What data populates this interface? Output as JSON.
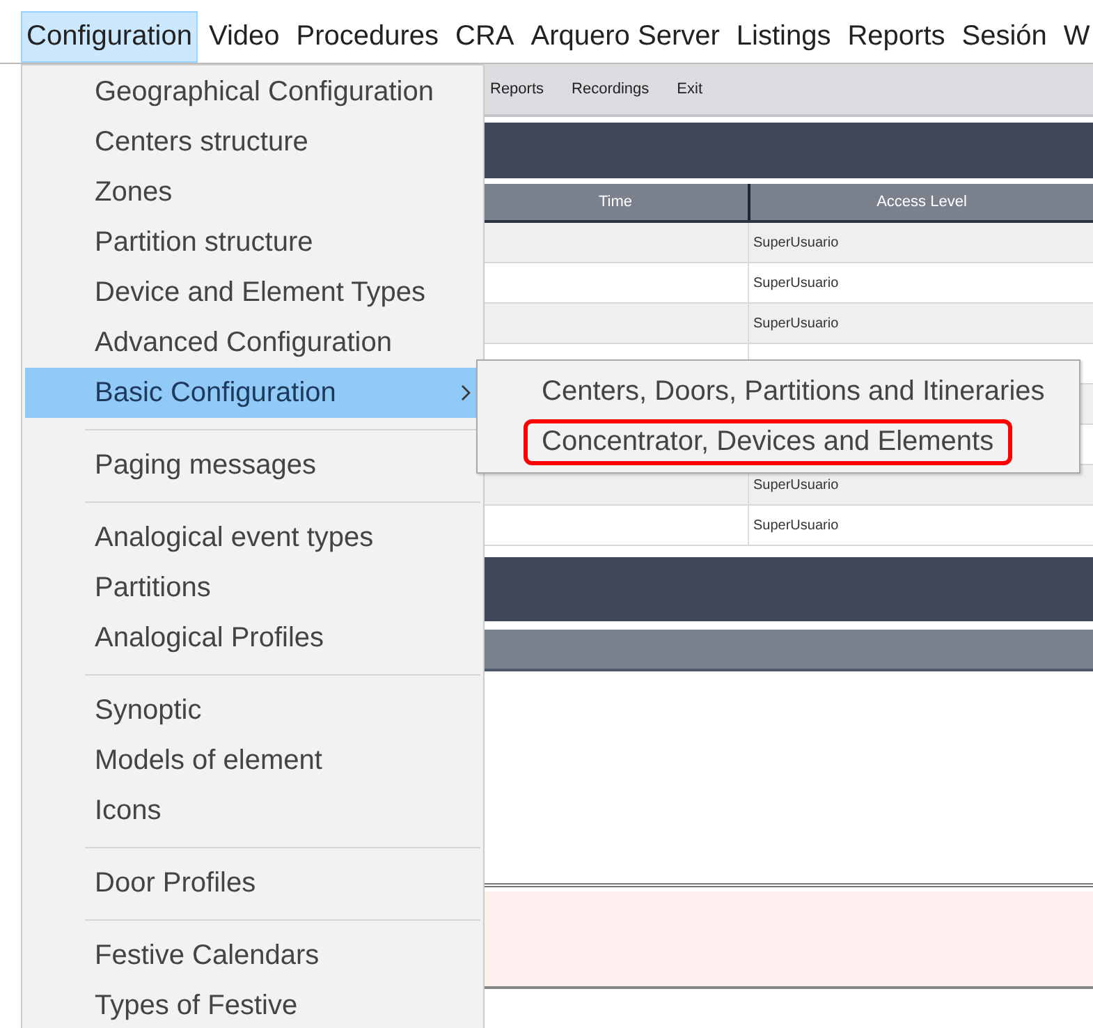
{
  "menubar": [
    {
      "label": "Configuration",
      "selected": true
    },
    {
      "label": "Video",
      "selected": false
    },
    {
      "label": "Procedures",
      "selected": false
    },
    {
      "label": "CRA",
      "selected": false
    },
    {
      "label": "Arquero Server",
      "selected": false
    },
    {
      "label": "Listings",
      "selected": false
    },
    {
      "label": "Reports",
      "selected": false
    },
    {
      "label": "Sesión",
      "selected": false
    },
    {
      "label": "W",
      "selected": false
    }
  ],
  "menu": {
    "groups": [
      {
        "items": [
          {
            "label": "Geographical Configuration",
            "selected": false,
            "has_submenu": false
          },
          {
            "label": "Centers structure",
            "selected": false,
            "has_submenu": false
          },
          {
            "label": "Zones",
            "selected": false,
            "has_submenu": false
          },
          {
            "label": "Partition structure",
            "selected": false,
            "has_submenu": false
          },
          {
            "label": "Device and Element Types",
            "selected": false,
            "has_submenu": false
          },
          {
            "label": "Advanced Configuration",
            "selected": false,
            "has_submenu": false
          },
          {
            "label": "Basic Configuration",
            "selected": true,
            "has_submenu": true
          }
        ]
      },
      {
        "items": [
          {
            "label": "Paging messages",
            "selected": false,
            "has_submenu": false
          }
        ]
      },
      {
        "items": [
          {
            "label": "Analogical event types",
            "selected": false,
            "has_submenu": false
          },
          {
            "label": "Partitions",
            "selected": false,
            "has_submenu": false
          },
          {
            "label": "Analogical Profiles",
            "selected": false,
            "has_submenu": false
          }
        ]
      },
      {
        "items": [
          {
            "label": "Synoptic",
            "selected": false,
            "has_submenu": false
          },
          {
            "label": "Models of element",
            "selected": false,
            "has_submenu": false
          },
          {
            "label": "Icons",
            "selected": false,
            "has_submenu": false
          }
        ]
      },
      {
        "items": [
          {
            "label": "Door Profiles",
            "selected": false,
            "has_submenu": false
          }
        ]
      },
      {
        "items": [
          {
            "label": "Festive Calendars",
            "selected": false,
            "has_submenu": false
          },
          {
            "label": "Types of Festive",
            "selected": false,
            "has_submenu": false
          }
        ]
      }
    ]
  },
  "submenu": {
    "items": [
      {
        "label": "Centers, Doors, Partitions and Itineraries",
        "annotated": false
      },
      {
        "label": "Concentrator, Devices and Elements",
        "annotated": true
      }
    ]
  },
  "app": {
    "toolbar": [
      "Reports",
      "Recordings",
      "Exit"
    ],
    "table": {
      "columns": [
        "Time",
        "Access Level"
      ],
      "rows": [
        {
          "access_level": "SuperUsuario"
        },
        {
          "access_level": "SuperUsuario"
        },
        {
          "access_level": "SuperUsuario"
        },
        {},
        {},
        {},
        {
          "access_level": "SuperUsuario"
        },
        {
          "access_level": "SuperUsuario"
        }
      ]
    }
  }
}
